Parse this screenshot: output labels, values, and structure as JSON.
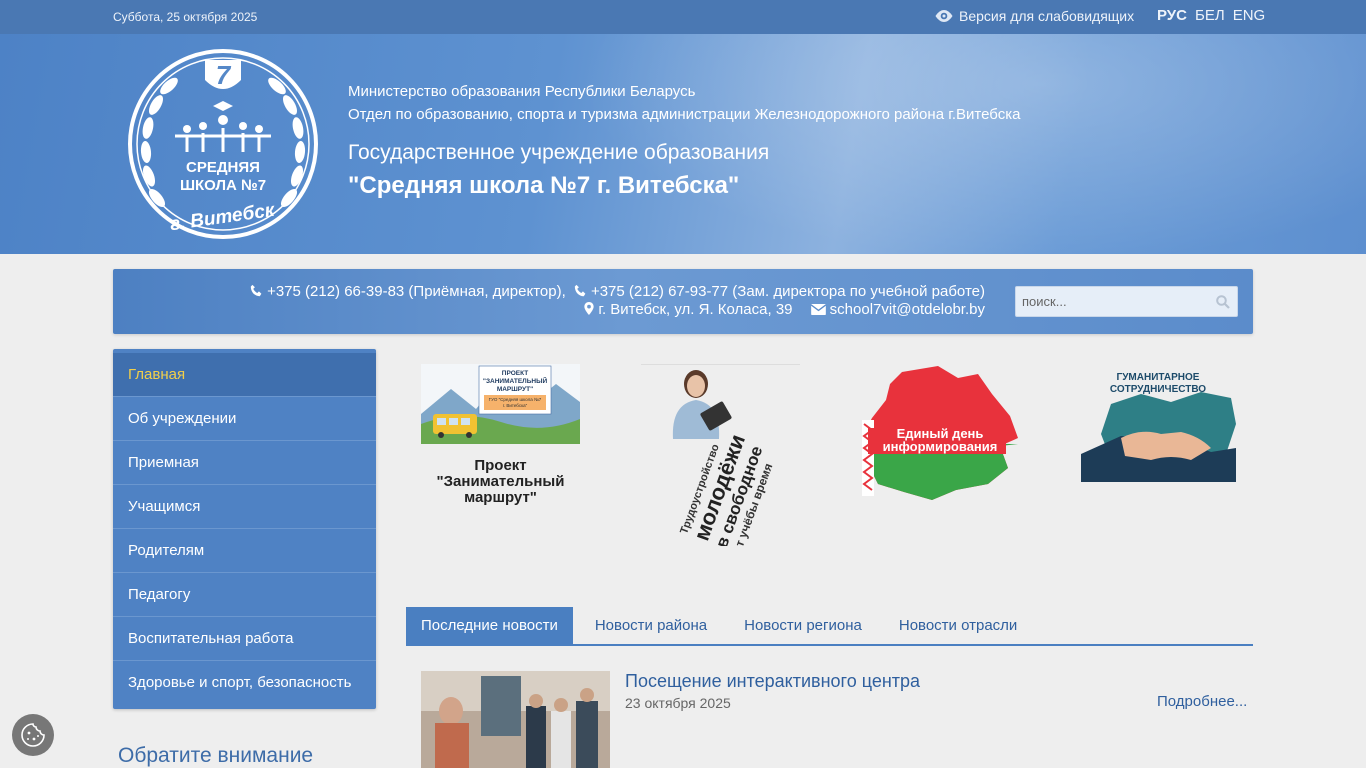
{
  "topbar": {
    "date": "Суббота, 25 октября 2025",
    "vision_label": "Версия для слабовидящих",
    "vision_icon": "eye-icon",
    "languages": [
      "РУС",
      "БЕЛ",
      "ENG"
    ],
    "active_language": "РУС"
  },
  "header": {
    "logo": {
      "number": "7",
      "line1": "СРЕДНЯЯ",
      "line2": "ШКОЛА №7",
      "city": "г. Витебск"
    },
    "ministry": "Министерство образования Республики Беларусь",
    "department": "Отдел по образованию, спорта и туризма администрации Железнодорожного района г.Витебска",
    "institution_type": "Государственное учреждение образования",
    "institution_name": "\"Средняя школа №7 г. Витебска\""
  },
  "contacts": {
    "phone1": "+375 (212) 66-39-83 (Приёмная, директор),",
    "phone2": "+375 (212) 67-93-77 (Зам. директора по учебной работе)",
    "address": "г. Витебск, ул. Я. Коласа, 39",
    "email": "school7vit@otdelobr.by",
    "search_placeholder": "поиск..."
  },
  "sidebar": {
    "items": [
      {
        "label": "Главная"
      },
      {
        "label": "Об учреждении"
      },
      {
        "label": "Приемная"
      },
      {
        "label": "Учащимся"
      },
      {
        "label": "Родителям"
      },
      {
        "label": "Педагогу"
      },
      {
        "label": "Воспитательная работа"
      },
      {
        "label": "Здоровье и спорт, безопасность"
      }
    ],
    "active_index": 0,
    "attention_heading": "Обратите внимание"
  },
  "banners": [
    {
      "image_text_line1": "ПРОЕКТ",
      "image_text_line2": "\"ЗАНИМАТЕЛЬНЫЙ",
      "image_text_line3": "МАРШРУТ\"",
      "image_text_line4": "ГУО \"Средняя школа №7",
      "image_text_line5": "г. Витебска\"",
      "caption": "Проект \"Занимательный маршрут\""
    },
    {
      "image_text_line1": "Трудоустройство",
      "image_text_line2": "молодёжи",
      "image_text_line3": "в свободное",
      "image_text_line4": "от учёбы время"
    },
    {
      "image_text_line1": "Единый день",
      "image_text_line2": "информирования"
    },
    {
      "image_text_line1": "ГУМАНИТАРНОЕ",
      "image_text_line2": "СОТРУДНИЧЕСТВО"
    }
  ],
  "news_tabs": {
    "tabs": [
      "Последние новости",
      "Новости района",
      "Новости региона",
      "Новости отрасли"
    ],
    "active_index": 0
  },
  "news": [
    {
      "title": "Посещение интерактивного центра",
      "date": "23 октября 2025",
      "more_label": "Подробнее..."
    }
  ],
  "colors": {
    "topbar": "#4a78b3",
    "menu": "#4f82c4",
    "menu_active_text": "#f2cf4a",
    "link": "#2f5f9e"
  },
  "cookie": {
    "icon": "cookie-icon"
  }
}
